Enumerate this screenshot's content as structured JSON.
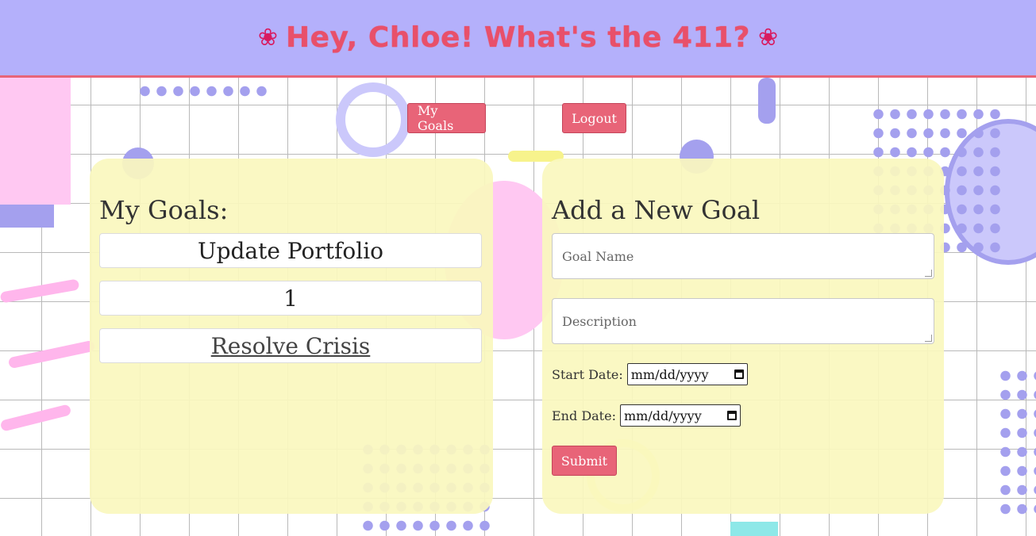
{
  "header": {
    "left_icon": "hibiscus",
    "title": "Hey, Chloe! What's the 411?",
    "right_icon": "hibiscus"
  },
  "nav": {
    "my_goals": "My Goals",
    "logout": "Logout"
  },
  "goals_panel": {
    "title": "My Goals:",
    "goals": [
      "Update Portfolio",
      "1",
      "Resolve Crisis"
    ]
  },
  "new_goal_form": {
    "title": "Add a New Goal",
    "goal_name_placeholder": "Goal Name",
    "description_placeholder": "Description",
    "start_date_label": "Start Date:",
    "end_date_label": "End Date:",
    "date_placeholder": "mm/dd/yyyy",
    "submit": "Submit"
  },
  "colors": {
    "header_bg": "#b4b0fb",
    "accent": "#e86478",
    "panel_bg": "#faf7be",
    "lavender": "#a4a0ee"
  }
}
